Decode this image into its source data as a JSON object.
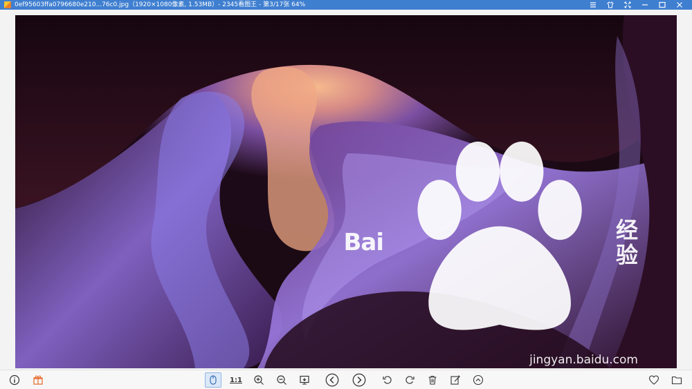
{
  "window": {
    "title": "0ef95603ffa0796680e210...76c0.jpg（1920×1080像素, 1.53MB）- 2345看图王 - 第3/17张 64%",
    "controls": [
      "menu-icon",
      "skin-icon",
      "fullscreen-icon",
      "minimize-icon",
      "maximize-icon",
      "close-icon"
    ]
  },
  "watermark": {
    "brand_left": "Bai",
    "brand_right": "经验",
    "url": "jingyan.baidu.com"
  },
  "toolbar": {
    "actual_size_label": "1:1",
    "left_icons": [
      "info-icon",
      "gift-icon"
    ],
    "center_icons": [
      "mouse-mode-icon",
      "actual-size-icon",
      "zoom-in-icon",
      "zoom-out-icon",
      "fit-screen-icon",
      "previous-icon",
      "next-icon",
      "rotate-left-icon",
      "rotate-right-icon",
      "delete-icon",
      "edit-icon",
      "more-icon"
    ],
    "right_icons": [
      "favorite-icon",
      "folder-icon"
    ]
  }
}
